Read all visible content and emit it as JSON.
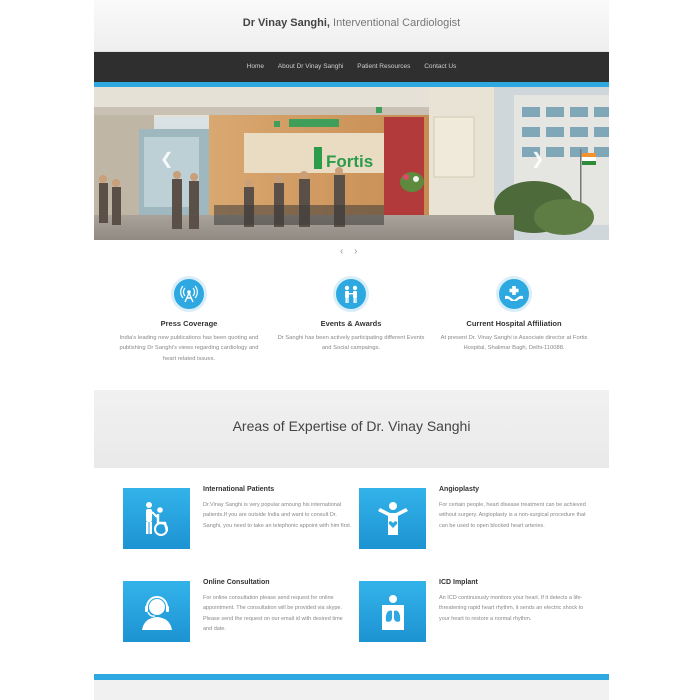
{
  "header": {
    "name": "Dr Vinay Sanghi,",
    "subtitle": " Interventional Cardiologist"
  },
  "nav": {
    "items": [
      "Home",
      "About Dr Vinay Sanghi",
      "Patient Resources",
      "Contact Us"
    ]
  },
  "slider": {
    "prev_glyph": "❮",
    "next_glyph": "❯",
    "dots": "‹ ›",
    "logo_text": "Fortis"
  },
  "features": [
    {
      "title": "Press Coverage",
      "text": "India's leading new publications has been quoting and publishing Dr Sanghi's views regarding cardiology and heart related issues.",
      "icon": "antenna-icon"
    },
    {
      "title": "Events & Awards",
      "text": "Dr Sanghi has been actively participating different Events and Social campaings.",
      "icon": "people-icon"
    },
    {
      "title": "Current Hospital Affiliation",
      "text": "At present Dr. Vinay Sanghi is Associate director at Fortis Hospital, Shalimar Bagh, Delhi-110088.",
      "icon": "hands-cross-icon"
    }
  ],
  "expertise": {
    "heading": "Areas of Expertise of Dr. Vinay Sanghi",
    "items": [
      {
        "title": "International Patients",
        "text": "Dr.Vinay Sanghi is very popular amoung his international patients.If you are outside India and want to consult Dr. Sanghi, you need to take an telephonic appoint with him first.",
        "icon": "wheelchair-icon"
      },
      {
        "title": "Angioplasty",
        "text": "For certain people, heart disease treatment can be achieved without surgery. Angioplasty is a non-surgical procedure that can be used to open blocked heart arteries.",
        "icon": "person-heart-icon"
      },
      {
        "title": "Online Consultation",
        "text": "For online consultation please send request for online appointment. The consultation will be provided via skype. Please send the request on our email id with desired time and date.",
        "icon": "headset-icon"
      },
      {
        "title": "ICD Implant",
        "text": "An ICD continuously monitors your heart. If it detects a life-threatening rapid heart rhythm, it sends an electric shock to your heart to restore a normal rhythm.",
        "icon": "lungs-body-icon"
      }
    ]
  },
  "colors": {
    "accent": "#2ea8e0",
    "nav_bg": "#2f2f2f"
  }
}
